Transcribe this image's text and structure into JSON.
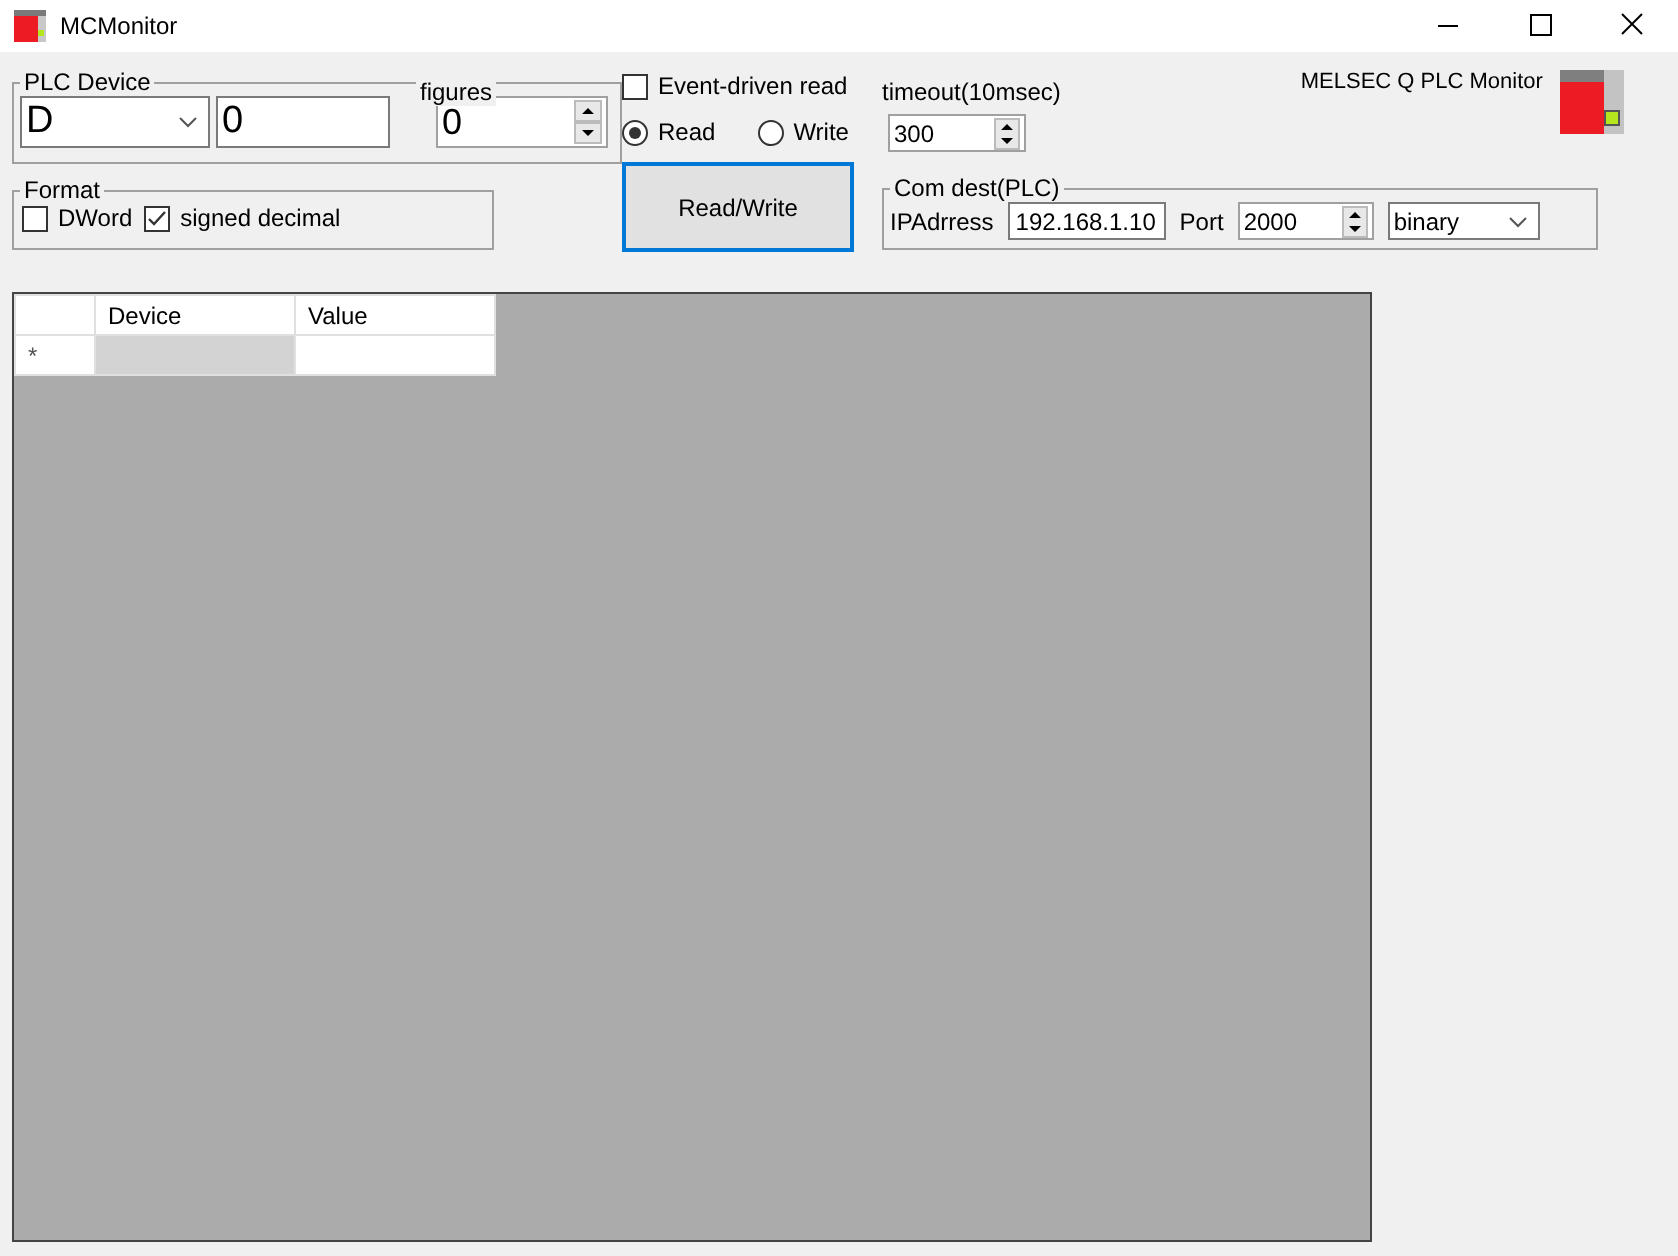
{
  "window": {
    "title": "MCMonitor"
  },
  "plc_device": {
    "label": "PLC Device",
    "device_type": "D",
    "address": "0"
  },
  "figures": {
    "label": "figures",
    "value": "0"
  },
  "format": {
    "label": "Format",
    "options": [
      {
        "label": "DWord",
        "checked": false
      },
      {
        "label": "signed decimal",
        "checked": true
      }
    ]
  },
  "event_driven": {
    "label": "Event-driven read",
    "checked": false
  },
  "mode": [
    {
      "label": "Read",
      "selected": true
    },
    {
      "label": "Write",
      "selected": false
    }
  ],
  "action_button": "Read/Write",
  "timeout": {
    "label": "timeout(10msec)",
    "value": "300"
  },
  "app_label": "MELSEC Q PLC Monitor",
  "com_dest": {
    "label": "Com dest(PLC)",
    "ip_label": "IPAdrress",
    "ip": "192.168.1.10",
    "port_label": "Port",
    "port": "2000",
    "protocol": "binary"
  },
  "table": {
    "columns": [
      "Device",
      "Value"
    ],
    "rows": [
      {
        "marker": "*"
      }
    ]
  }
}
